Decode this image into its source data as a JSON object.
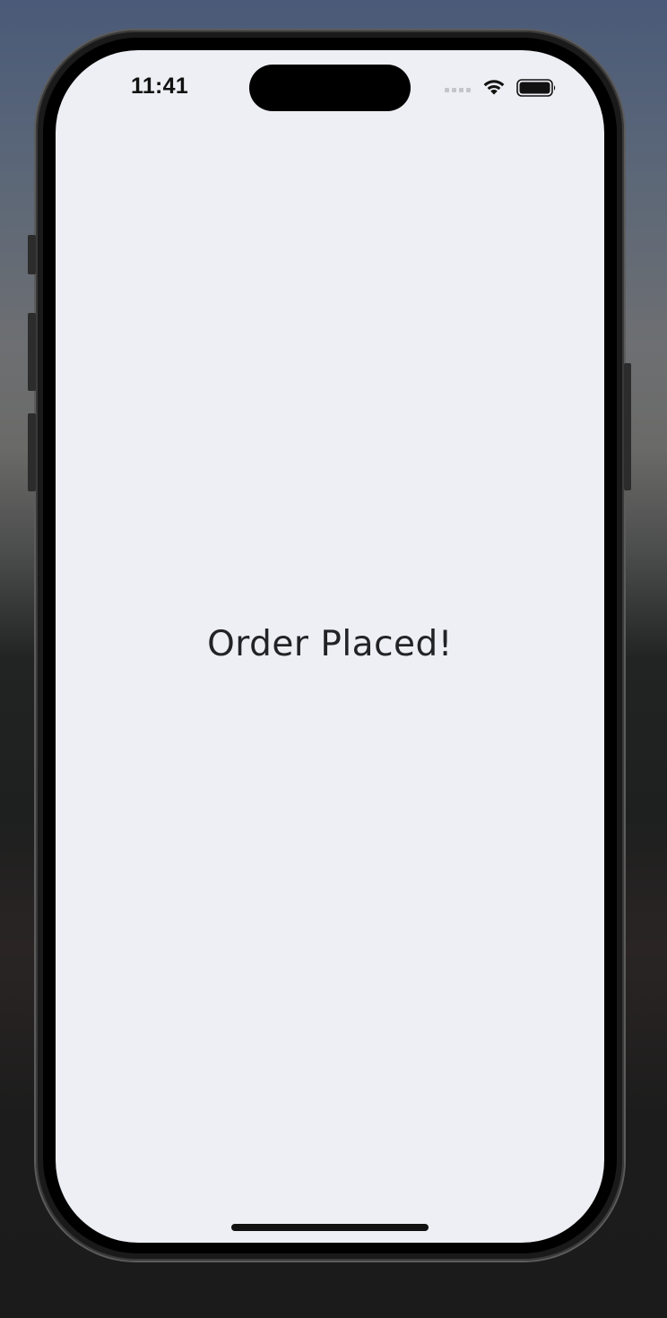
{
  "status_bar": {
    "time": "11:41",
    "icons": [
      "cellular-signal-icon",
      "wifi-icon",
      "battery-icon"
    ]
  },
  "main": {
    "message": "Order Placed!"
  },
  "colors": {
    "screen_background": "#eeeff4",
    "text": "#232327",
    "device_frame": "#000000"
  }
}
